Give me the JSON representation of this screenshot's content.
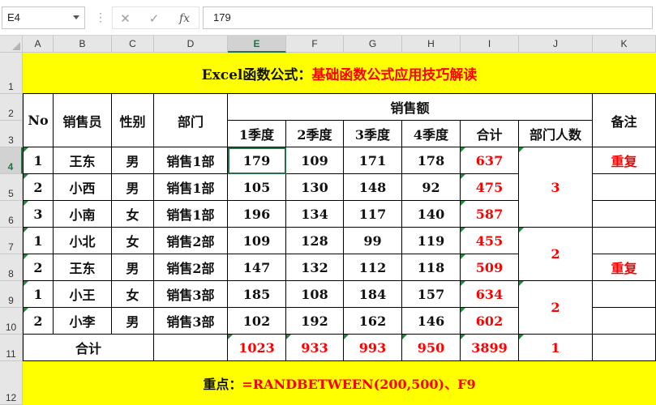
{
  "formula_bar": {
    "name_box": "E4",
    "separator": "⋮",
    "cancel_icon": "✕",
    "enter_icon": "✓",
    "fx_label": "fx",
    "formula": "179"
  },
  "colors": {
    "yellow": "#ffff00",
    "red": "#ff0000",
    "excel_green": "#217346"
  },
  "columns": [
    "A",
    "B",
    "C",
    "D",
    "E",
    "F",
    "G",
    "H",
    "I",
    "J",
    "K"
  ],
  "rows": [
    "1",
    "2",
    "3",
    "4",
    "5",
    "6",
    "7",
    "8",
    "9",
    "10",
    "11",
    "12"
  ],
  "sheet": {
    "title_black": "Excel函数公式：",
    "title_red": "基础函数公式应用技巧解读",
    "headers": {
      "no": "No",
      "salesperson": "销售员",
      "gender": "性别",
      "dept": "部门",
      "sales": "销售额",
      "q1": "1季度",
      "q2": "2季度",
      "q3": "3季度",
      "q4": "4季度",
      "total": "合计",
      "dept_count": "部门人数",
      "remark": "备注"
    },
    "records": [
      {
        "no": "1",
        "name": "王东",
        "gender": "男",
        "dept": "销售1部",
        "q1": "179",
        "q2": "109",
        "q3": "171",
        "q4": "178",
        "total": "637",
        "remark": "重复"
      },
      {
        "no": "2",
        "name": "小西",
        "gender": "男",
        "dept": "销售1部",
        "q1": "105",
        "q2": "130",
        "q3": "148",
        "q4": "92",
        "total": "475",
        "remark": ""
      },
      {
        "no": "3",
        "name": "小南",
        "gender": "女",
        "dept": "销售1部",
        "q1": "196",
        "q2": "134",
        "q3": "117",
        "q4": "140",
        "total": "587",
        "remark": ""
      },
      {
        "no": "1",
        "name": "小北",
        "gender": "女",
        "dept": "销售2部",
        "q1": "109",
        "q2": "128",
        "q3": "99",
        "q4": "119",
        "total": "455",
        "remark": ""
      },
      {
        "no": "2",
        "name": "王东",
        "gender": "男",
        "dept": "销售2部",
        "q1": "147",
        "q2": "132",
        "q3": "112",
        "q4": "118",
        "total": "509",
        "remark": "重复"
      },
      {
        "no": "1",
        "name": "小王",
        "gender": "女",
        "dept": "销售3部",
        "q1": "185",
        "q2": "108",
        "q3": "184",
        "q4": "157",
        "total": "634",
        "remark": ""
      },
      {
        "no": "2",
        "name": "小李",
        "gender": "男",
        "dept": "销售3部",
        "q1": "102",
        "q2": "192",
        "q3": "162",
        "q4": "146",
        "total": "602",
        "remark": ""
      }
    ],
    "dept_counts": [
      "3",
      "2",
      "2"
    ],
    "totals": {
      "label": "合计",
      "q1": "1023",
      "q2": "933",
      "q3": "993",
      "q4": "950",
      "total": "3899",
      "dept_count": "1"
    },
    "note_label": "重点：",
    "note_formula": "=RANDBETWEEN(200,500)、F9"
  }
}
